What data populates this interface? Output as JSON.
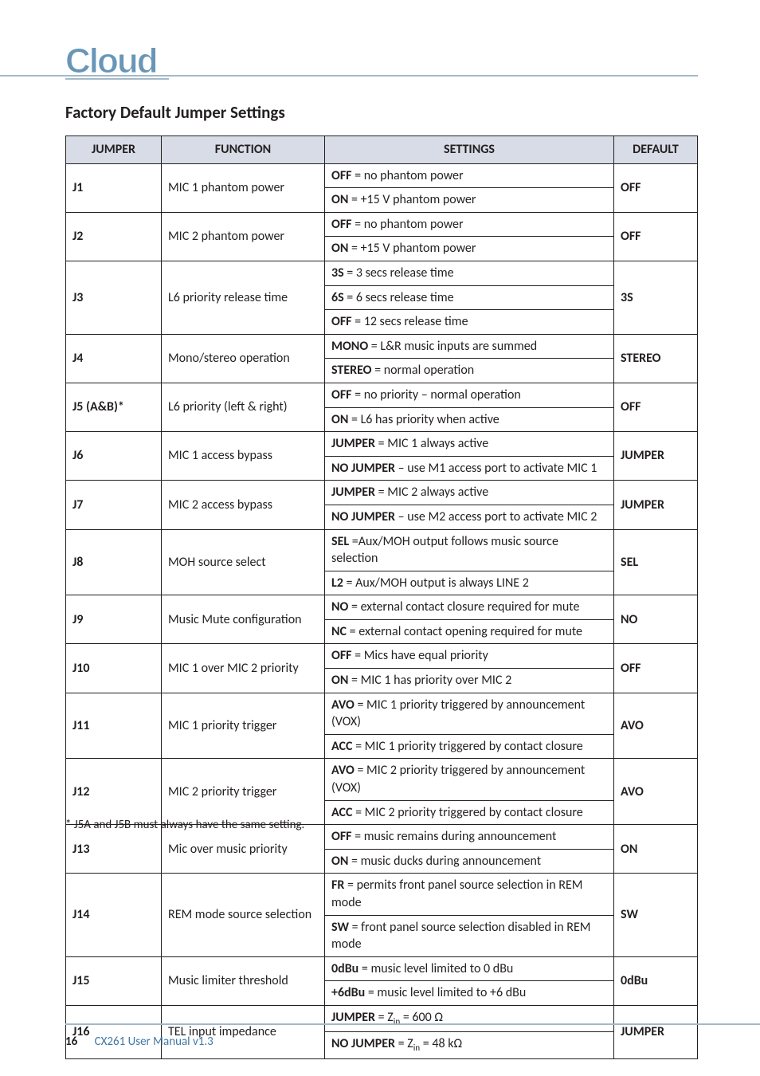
{
  "logo_text": "Cloud",
  "heading": "Factory Default Jumper Settings",
  "columns": {
    "jumper": "JUMPER",
    "function": "FUNCTION",
    "settings": "SETTINGS",
    "default": "DEFAULT"
  },
  "rows": [
    {
      "jumper": "J1",
      "function": "MIC 1 phantom power",
      "settings": [
        "<b>OFF</b> = no phantom power",
        "<b>ON</b> = +15 V phantom power"
      ],
      "default": "OFF"
    },
    {
      "jumper": "J2",
      "function": "MIC 2 phantom power",
      "settings": [
        "<b>OFF</b> = no phantom power",
        "<b>ON</b> = +15 V phantom power"
      ],
      "default": "OFF"
    },
    {
      "jumper": "J3",
      "function": "L6 priority release time",
      "settings": [
        "<b>3S</b> = 3 secs release time",
        "<b>6S</b> = 6 secs release time",
        "<b>OFF</b> = 12 secs release time"
      ],
      "default": "3S"
    },
    {
      "jumper": "J4",
      "function": "Mono/stereo operation",
      "settings": [
        "<b>MONO</b> = L&amp;R music inputs are summed",
        "<b>STEREO</b> = normal operation"
      ],
      "default": "STEREO"
    },
    {
      "jumper": "J5 (A&B)*",
      "function": "L6 priority (left & right)",
      "settings": [
        "<b>OFF</b> = no priority – normal operation",
        "<b>ON</b> = L6 has priority when active"
      ],
      "default": "OFF"
    },
    {
      "jumper": "J6",
      "function": "MIC 1 access bypass",
      "settings": [
        "<b>JUMPER</b> = MIC 1 always active",
        "<b>NO JUMPER</b> – use M1 access port to activate MIC 1"
      ],
      "default": "JUMPER"
    },
    {
      "jumper": "J7",
      "function": "MIC 2 access bypass",
      "settings": [
        "<b>JUMPER</b> = MIC 2 always active",
        "<b>NO JUMPER</b> – use M2 access port to activate MIC 2"
      ],
      "default": "JUMPER"
    },
    {
      "jumper": "J8",
      "function": "MOH source select",
      "settings": [
        "<b>SEL</b> =Aux/MOH output follows music source selection",
        "<b>L2</b> = Aux/MOH output is always LINE 2"
      ],
      "default": "SEL"
    },
    {
      "jumper": "J9",
      "function": "Music Mute configuration",
      "settings": [
        "<b>NO</b> = external contact closure required for mute",
        "<b>NC</b> = external contact opening required for mute"
      ],
      "default": "NO"
    },
    {
      "jumper": "J10",
      "function": "MIC 1 over MIC 2 priority",
      "settings": [
        "<b>OFF</b> = Mics have equal priority",
        "<b>ON</b> = MIC 1 has priority over MIC 2"
      ],
      "default": "OFF"
    },
    {
      "jumper": "J11",
      "function": "MIC 1 priority trigger",
      "settings": [
        "<b>AVO</b> = MIC 1 priority triggered by announcement (VOX)",
        "<b>ACC</b> = MIC 1 priority triggered by contact closure"
      ],
      "default": "AVO"
    },
    {
      "jumper": "J12",
      "function": "MIC 2 priority trigger",
      "settings": [
        "<b>AVO</b> = MIC 2 priority triggered by announcement (VOX)",
        "<b>ACC</b> = MIC 2 priority triggered by contact closure"
      ],
      "default": "AVO"
    },
    {
      "jumper": "J13",
      "function": "Mic over music priority",
      "settings": [
        "<b>OFF</b> = music remains during announcement",
        "<b>ON</b> = music ducks during announcement"
      ],
      "default": "ON"
    },
    {
      "jumper": "J14",
      "function": "REM mode source selection",
      "settings": [
        "<b>FR</b> = permits front panel source selection in REM mode",
        "<b>SW</b> = front panel source selection disabled in REM mode"
      ],
      "default": "SW"
    },
    {
      "jumper": "J15",
      "function": "Music limiter threshold",
      "settings": [
        "<b>0dBu</b> = music level limited to 0 dBu",
        "<b>+6dBu</b> = music level limited to +6 dBu"
      ],
      "default": "0dBu"
    },
    {
      "jumper": "J16",
      "function": "TEL input impedance",
      "settings": [
        "<b>JUMPER</b> = Z<sub>in</sub> = 600 Ω",
        "<b>NO JUMPER</b> = Z<sub>in</sub> = 48 kΩ"
      ],
      "default": "JUMPER"
    }
  ],
  "footnote": "* J5A and J5B must always have the same setting.",
  "footer": {
    "page": "16",
    "docref": "CX261 User Manual v1.3"
  }
}
